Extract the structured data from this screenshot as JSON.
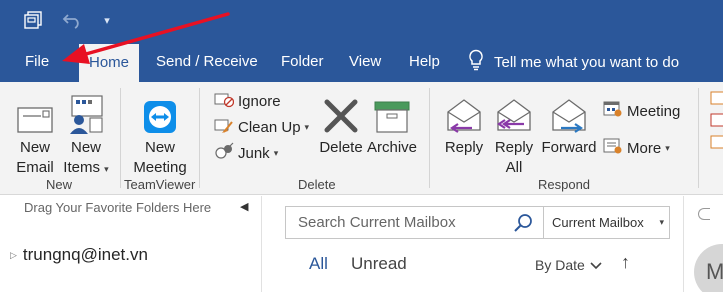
{
  "quick_access": {
    "icons": [
      "save-icon",
      "undo-icon",
      "customize-qat-icon"
    ],
    "more_glyph": "▾"
  },
  "tabs": [
    {
      "label": "File"
    },
    {
      "label": "Home",
      "active": true
    },
    {
      "label": "Send / Receive"
    },
    {
      "label": "Folder"
    },
    {
      "label": "View"
    },
    {
      "label": "Help"
    }
  ],
  "tell_me": "Tell me what you want to do",
  "ribbon": {
    "new_group": {
      "label": "New",
      "new_email": [
        "New",
        "Email"
      ],
      "new_items": [
        "New",
        "Items"
      ]
    },
    "teamviewer_group": {
      "label": "TeamViewer",
      "new_meeting": [
        "New",
        "Meeting"
      ]
    },
    "delete_group": {
      "label": "Delete",
      "ignore": "Ignore",
      "clean_up": "Clean Up",
      "junk": "Junk",
      "delete": "Delete",
      "archive": "Archive"
    },
    "respond_group": {
      "label": "Respond",
      "reply": "Reply",
      "reply_all": [
        "Reply",
        "All"
      ],
      "forward": "Forward",
      "meeting": "Meeting",
      "more": "More"
    }
  },
  "folder_pane": {
    "favorites_hint": "Drag Your Favorite Folders Here",
    "account": "trungnq@inet.vn"
  },
  "mail_pane": {
    "search_placeholder": "Search Current Mailbox",
    "scope": "Current Mailbox",
    "filters": [
      "All",
      "Unread"
    ],
    "sort_by": "By Date",
    "sort_direction": "↑"
  },
  "reading_pane": {
    "avatar_initial": "M"
  },
  "colors": {
    "accent": "#2b579a",
    "ribbon_bg": "#f3f3f3",
    "annotation": "#e81123"
  }
}
